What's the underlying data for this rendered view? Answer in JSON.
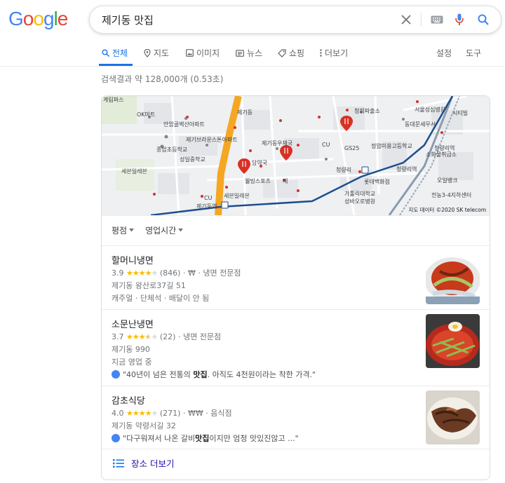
{
  "logo": {
    "text": "Google"
  },
  "search": {
    "query": "제기동 맛집"
  },
  "tabs": {
    "all": "전체",
    "maps": "지도",
    "images": "이미지",
    "news": "뉴스",
    "shopping": "쇼핑",
    "more": "더보기",
    "settings": "설정",
    "tools": "도구"
  },
  "stats": "검색결과 약 128,000개 (0.53초)",
  "map": {
    "labels": [
      "계림퍼스",
      "OK마트",
      "안암골벽산아파트",
      "제기동",
      "청회파출소",
      "서울성심병원",
      "시티빌",
      "동대문세무서",
      "제기브라운스톤아파트",
      "종암초등학교",
      "제기동우체국",
      "CU",
      "GS25",
      "정암미용고등학교",
      "청량리역",
      "소화물취급소",
      "성일중학교",
      "당약국",
      "세븐일레븐",
      "청량리",
      "청량리역",
      "롯데백화점",
      "오일뱅크",
      "웰빙스포츠",
      "제",
      "가톨릭대학교",
      "성바오로병원",
      "전농3-4지하센터",
      "CU",
      "세븐일레븐",
      "제기동역"
    ],
    "credit": "지도 데이터 ©2020 SK telecom"
  },
  "filters": {
    "rating": "평점",
    "hours": "영업시간"
  },
  "places": [
    {
      "name": "할머니냉면",
      "rating": "3.9",
      "stars": 4,
      "reviews": "(846)",
      "price": "₩",
      "category": "냉면 전문점",
      "address": "제기동 왕산로37길 51",
      "extra": "캐주얼 · 단체석 · 배달이 안 됨"
    },
    {
      "name": "소문난냉면",
      "rating": "3.7",
      "stars": 3.5,
      "reviews": "(22)",
      "category": "냉면 전문점",
      "address": "제기동 990",
      "status": "지금 영업 중",
      "review_pre": "\"40년이 넘은 전통의 ",
      "review_bold": "맛집",
      "review_post": ". 아직도 4천원이라는 착한 가격.\""
    },
    {
      "name": "감초식당",
      "rating": "4.0",
      "stars": 4,
      "reviews": "(271)",
      "price": "₩₩",
      "category": "음식점",
      "address": "제기동 약령서길 32",
      "review_pre": "\"다구워져서 나온 갈비",
      "review_bold": "맛집",
      "review_post": "이지만 엄청 맛있진않고 ...\""
    }
  ],
  "more_places": "장소 더보기",
  "colors": {
    "accent": "#1a73e8",
    "star": "#fbbc04",
    "road": "#f5a623",
    "subway": "#1f4e8c"
  }
}
